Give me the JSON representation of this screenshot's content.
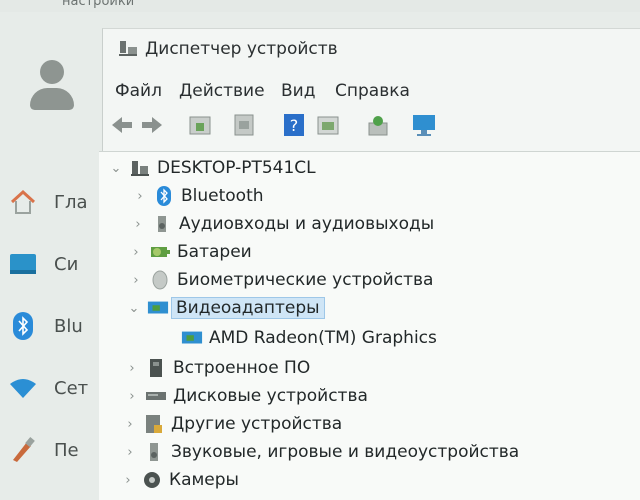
{
  "settings_bg": {
    "top_label": "настройки",
    "sidebar": [
      {
        "label": "Гла",
        "icon": "home-icon"
      },
      {
        "label": "Си",
        "icon": "system-icon"
      },
      {
        "label": "Blu",
        "icon": "bluetooth-icon"
      },
      {
        "label": "Сет",
        "icon": "network-icon"
      },
      {
        "label": "Пе",
        "icon": "personalization-icon"
      }
    ]
  },
  "window": {
    "title": "Диспетчер устройств",
    "menu": [
      "Файл",
      "Действие",
      "Вид",
      "Справка"
    ],
    "toolbar": [
      "back-icon",
      "forward-icon",
      "properties-icon",
      "update-driver-icon",
      "help-icon",
      "view-icon",
      "scan-hardware-icon",
      "monitor-icon"
    ]
  },
  "tree": {
    "root": "DESKTOP-PT541CL",
    "items": [
      {
        "label": "Bluetooth",
        "icon": "bluetooth-icon",
        "expanded": false
      },
      {
        "label": "Аудиовходы и аудиовыходы",
        "icon": "speaker-icon",
        "expanded": false
      },
      {
        "label": "Батареи",
        "icon": "battery-icon",
        "expanded": false
      },
      {
        "label": "Биометрические устройства",
        "icon": "fingerprint-icon",
        "expanded": false
      },
      {
        "label": "Видеоадаптеры",
        "icon": "display-adapter-icon",
        "expanded": true,
        "selected": true
      },
      {
        "label": "AMD Radeon(TM) Graphics",
        "icon": "display-adapter-icon",
        "child": true
      },
      {
        "label": "Встроенное ПО",
        "icon": "firmware-icon",
        "expanded": false
      },
      {
        "label": "Дисковые устройства",
        "icon": "disk-icon",
        "expanded": false
      },
      {
        "label": "Другие устройства",
        "icon": "unknown-device-icon",
        "expanded": false
      },
      {
        "label": "Звуковые, игровые и видеоустройства",
        "icon": "sound-icon",
        "expanded": false
      },
      {
        "label": "Камеры",
        "icon": "camera-icon",
        "expanded": false
      }
    ]
  },
  "colors": {
    "accent": "#1a73c9",
    "selection": "#cfe5f6"
  }
}
